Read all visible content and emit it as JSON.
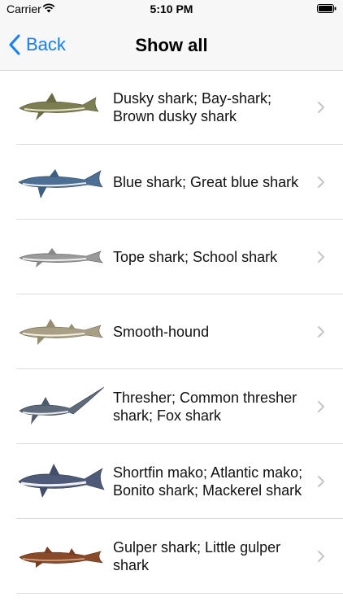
{
  "status": {
    "carrier": "Carrier",
    "time": "5:10 PM"
  },
  "nav": {
    "back_label": "Back",
    "title": "Show all"
  },
  "rows": [
    {
      "label": "Dusky shark; Bay-shark; Brown dusky shark"
    },
    {
      "label": "Blue shark; Great blue shark"
    },
    {
      "label": "Tope shark; School shark"
    },
    {
      "label": "Smooth-hound"
    },
    {
      "label": "Thresher; Common thresher shark; Fox shark"
    },
    {
      "label": "Shortfin mako; Atlantic mako; Bonito shark; Mackerel shark"
    },
    {
      "label": "Gulper shark; Little gulper shark"
    }
  ],
  "colors": {
    "accent": "#157efb",
    "nav_bg": "#f7f7f7",
    "separator": "#dcdcdc"
  }
}
